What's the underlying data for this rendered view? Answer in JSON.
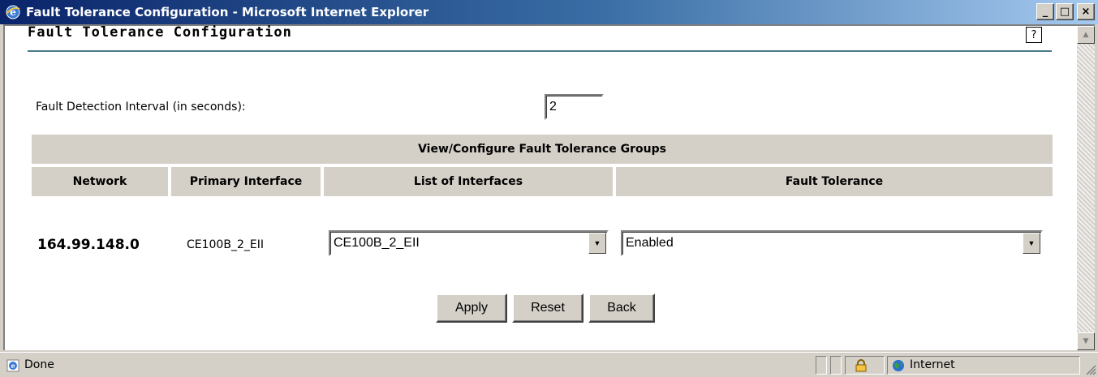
{
  "window": {
    "title": "Fault Tolerance Configuration - Microsoft Internet Explorer",
    "icon": "ie-icon",
    "buttons": {
      "minimize": "_",
      "maximize": "□",
      "close": "×"
    }
  },
  "page": {
    "title": "Fault Tolerance Configuration",
    "help_glyph": "?",
    "interval_label": "Fault Detection Interval (in seconds):",
    "interval_value": "2"
  },
  "table": {
    "group_header": "View/Configure Fault Tolerance Groups",
    "columns": [
      "Network",
      "Primary Interface",
      "List of Interfaces",
      "Fault Tolerance"
    ],
    "rows": [
      {
        "network": "164.99.148.0",
        "primary_interface": "CE100B_2_EII",
        "list_of_interfaces": "CE100B_2_EII",
        "fault_tolerance": "Enabled"
      }
    ]
  },
  "actions": {
    "apply": "Apply",
    "reset": "Reset",
    "back": "Back"
  },
  "statusbar": {
    "status": "Done",
    "zone": "Internet"
  },
  "colors": {
    "titlebar_start": "#0a246a",
    "titlebar_end": "#a6caf0",
    "rule": "#4a7a8c",
    "face": "#d4d0c8"
  }
}
